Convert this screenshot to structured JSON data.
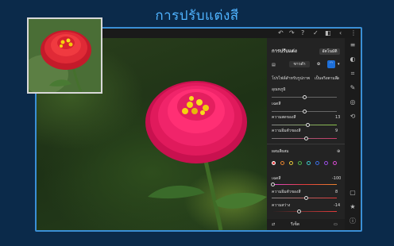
{
  "banner": {
    "title": "การปรับแต่งสี"
  },
  "header": {
    "panel_title": "การปรับแต่ง",
    "auto_button": "อัตโนมัติ",
    "preset_value": "ขาวดำ",
    "profile_label": "โปรไฟล์สำหรับรูปภาพ",
    "profile_value": "เป็นจริงตามสี"
  },
  "light_sliders": [
    {
      "label": "อุณหภูมิ",
      "value": "",
      "position": 0.5
    },
    {
      "label": "เฉดสี",
      "value": "",
      "position": 0.5
    },
    {
      "label": "ความสดของสี",
      "value": "13",
      "position": 0.56
    },
    {
      "label": "ความอิ่มตัวของสี",
      "value": "9",
      "position": 0.53
    }
  ],
  "mix": {
    "title": "ผสมสีผสม",
    "swatch_colors": [
      "#e33b3b",
      "#e8842f",
      "#e6c73a",
      "#4fb34a",
      "#3cc7c7",
      "#3b6ee3",
      "#9a4de3",
      "#d94bd3"
    ]
  },
  "mix_sliders": [
    {
      "label": "เฉดสี",
      "value": "-100",
      "position": 0.0
    },
    {
      "label": "ความอิ่มตัวของสี",
      "value": "8",
      "position": 0.53
    },
    {
      "label": "ความสว่าง",
      "value": "-14",
      "position": 0.42
    }
  ],
  "footer": {
    "reset_label": "รีเซ็ต"
  }
}
